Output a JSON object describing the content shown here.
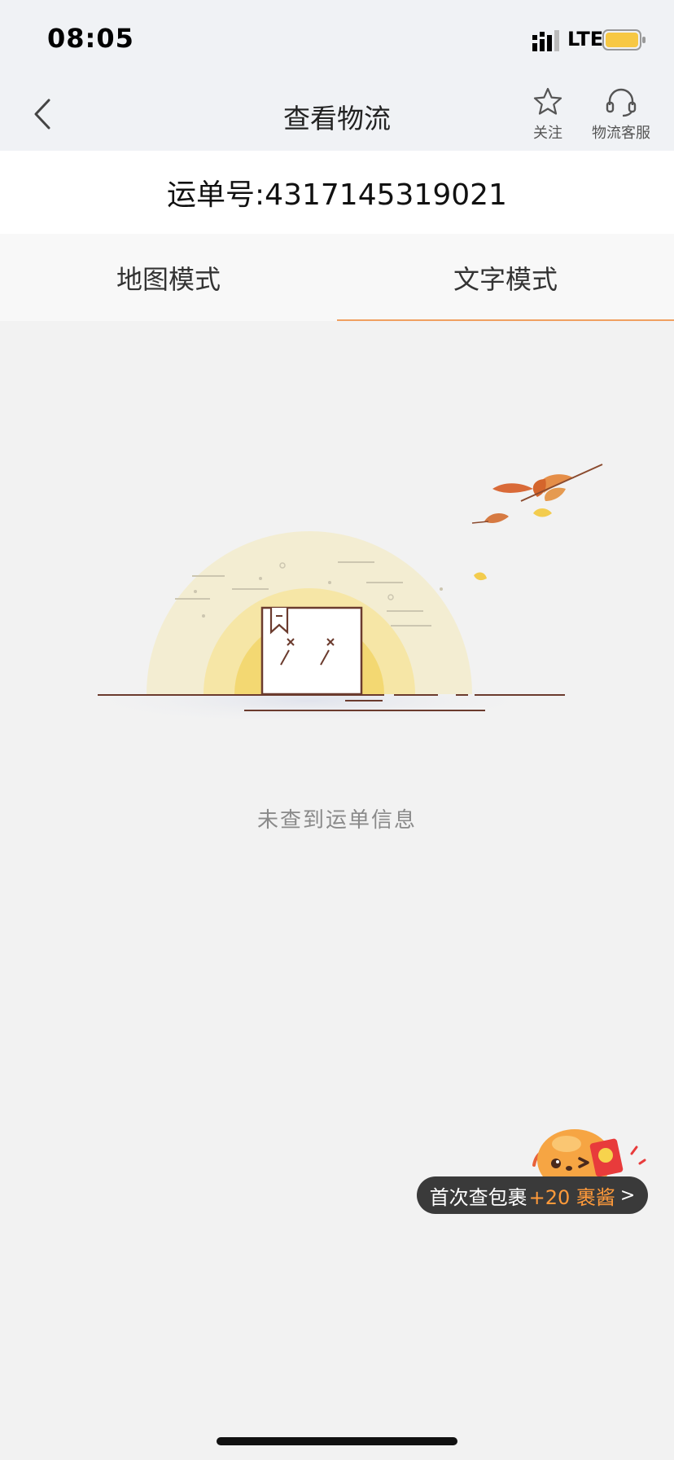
{
  "status_bar": {
    "time": "08:05",
    "network": "LTE"
  },
  "header": {
    "title": "查看物流",
    "follow_label": "关注",
    "service_label": "物流客服"
  },
  "waybill": {
    "text": "运单号:4317145319021"
  },
  "tabs": [
    {
      "label": "地图模式",
      "active": false
    },
    {
      "label": "文字模式",
      "active": true
    }
  ],
  "empty_state": {
    "message": "未查到运单信息"
  },
  "promo": {
    "prefix": "首次查包裹",
    "bonus": "+20 裹酱",
    "arrow": ">"
  },
  "colors": {
    "accent": "#f0a060",
    "bonus": "#ff9a3a",
    "pill": "#3a3a3a",
    "background": "#f2f2f2"
  }
}
